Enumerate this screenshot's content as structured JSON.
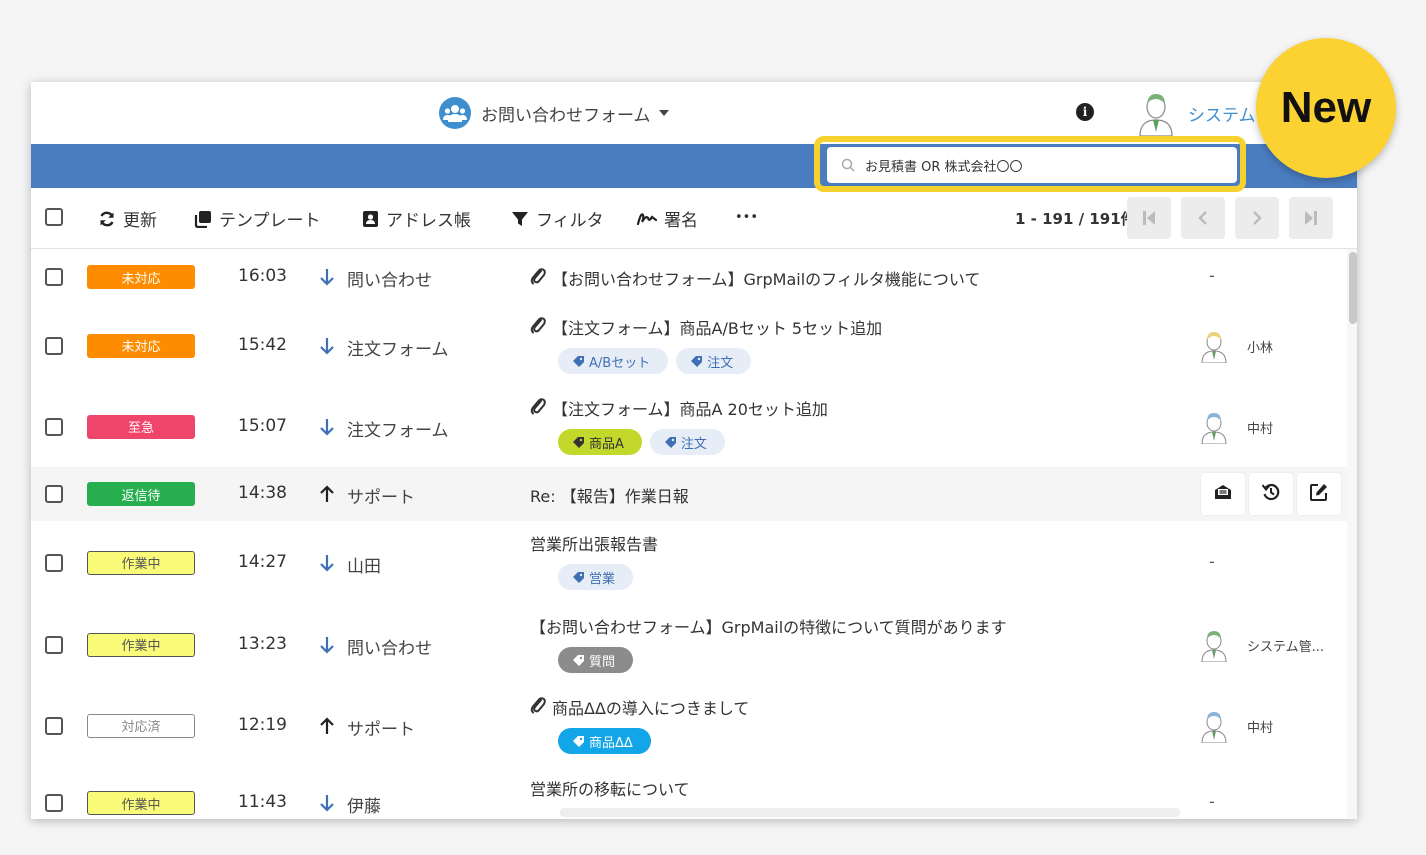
{
  "header": {
    "form_name": "お問い合わせフォーム",
    "user_name": "システム",
    "info_icon": "info-icon"
  },
  "search": {
    "value": "お見積書 OR 株式会社〇〇",
    "icon": "search-icon"
  },
  "toolbar": {
    "refresh_label": "更新",
    "template_label": "テンプレート",
    "address_book_label": "アドレス帳",
    "filter_label": "フィルタ",
    "signature_label": "署名",
    "more_label": "•••",
    "pagination_text": "1 - 191 / 191件"
  },
  "rows": [
    {
      "status": "未対応",
      "time": "16:03",
      "direction": "incoming",
      "sender": "問い合わせ",
      "attachment": true,
      "subject": "【お問い合わせフォーム】GrpMailのフィルタ機能について",
      "tags": [],
      "assignee": "-"
    },
    {
      "status": "未対応",
      "time": "15:42",
      "direction": "incoming",
      "sender": "注文フォーム",
      "attachment": true,
      "subject": "【注文フォーム】商品A/Bセット 5セット追加",
      "tags": [
        "A/Bセット",
        "注文"
      ],
      "assignee": "小林"
    },
    {
      "status": "至急",
      "time": "15:07",
      "direction": "incoming",
      "sender": "注文フォーム",
      "attachment": true,
      "subject": "【注文フォーム】商品A 20セット追加",
      "tags": [
        "商品A",
        "注文"
      ],
      "assignee": "中村"
    },
    {
      "status": "返信待",
      "time": "14:38",
      "direction": "outgoing",
      "sender": "サポート",
      "attachment": false,
      "subject": "Re: 【報告】作業日報",
      "tags": [],
      "assignee": ""
    },
    {
      "status": "作業中",
      "time": "14:27",
      "direction": "incoming",
      "sender": "山田",
      "attachment": false,
      "subject": "営業所出張報告書",
      "tags": [
        "営業"
      ],
      "assignee": "-"
    },
    {
      "status": "作業中",
      "time": "13:23",
      "direction": "incoming",
      "sender": "問い合わせ",
      "attachment": false,
      "subject": "【お問い合わせフォーム】GrpMailの特徴について質問があります",
      "tags": [
        "質問"
      ],
      "assignee": "システム管..."
    },
    {
      "status": "対応済",
      "time": "12:19",
      "direction": "outgoing",
      "sender": "サポート",
      "attachment": true,
      "subject": "商品ΔΔの導入につきまして",
      "tags": [
        "商品ΔΔ"
      ],
      "assignee": "中村"
    },
    {
      "status": "作業中",
      "time": "11:43",
      "direction": "incoming",
      "sender": "伊藤",
      "attachment": false,
      "subject": "営業所の移転について",
      "tags": [],
      "assignee": "-"
    }
  ],
  "row_actions": [
    "envelope-open-icon",
    "history-icon",
    "edit-icon"
  ],
  "colors": {
    "accent_blue": "#4a7dc0",
    "status_unhandled": "#ff8c00",
    "status_urgent": "#f0456b",
    "status_awaiting_reply": "#27ae4f",
    "status_in_progress": "#fbfb7a",
    "status_done": "#ffffff",
    "highlight": "#f7d22f"
  },
  "promo_badge": "New"
}
